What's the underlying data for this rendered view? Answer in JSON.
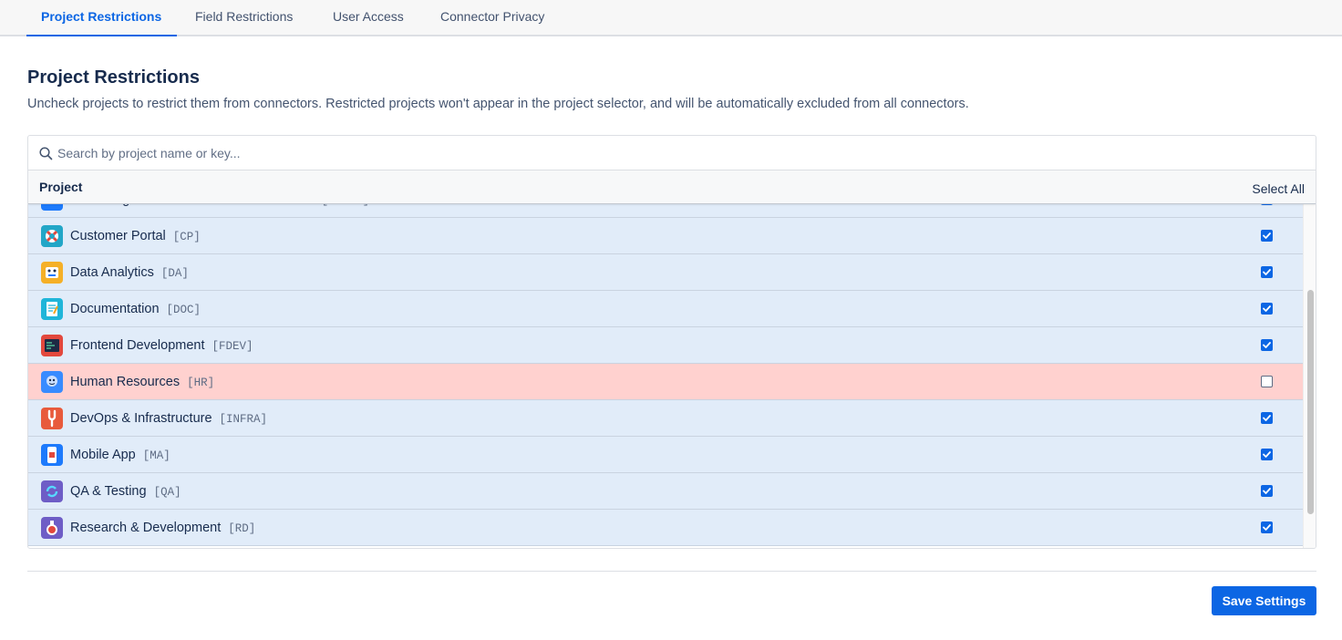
{
  "tabs": [
    {
      "label": "Project Restrictions",
      "active": true
    },
    {
      "label": "Field Restrictions",
      "active": false
    },
    {
      "label": "User Access",
      "active": false
    },
    {
      "label": "Connector Privacy",
      "active": false
    }
  ],
  "section": {
    "title": "Project Restrictions",
    "description": "Uncheck projects to restrict them from connectors. Restricted projects won't appear in the project selector, and will be automatically excluded from all connectors."
  },
  "search": {
    "placeholder": "Search by project name or key...",
    "value": ""
  },
  "table": {
    "header_project": "Project",
    "select_all": "Select All"
  },
  "projects": [
    {
      "name": "Cloud Migration & Modernization Initiative",
      "key": "[CLOUD]",
      "checked": true,
      "icon": "cloud-icon"
    },
    {
      "name": "Customer Portal",
      "key": "[CP]",
      "checked": true,
      "icon": "lifebuoy-icon"
    },
    {
      "name": "Data Analytics",
      "key": "[DA]",
      "checked": true,
      "icon": "robot-icon"
    },
    {
      "name": "Documentation",
      "key": "[DOC]",
      "checked": true,
      "icon": "notebook-icon"
    },
    {
      "name": "Frontend Development",
      "key": "[FDEV]",
      "checked": true,
      "icon": "code-editor-icon"
    },
    {
      "name": "Human Resources",
      "key": "[HR]",
      "checked": false,
      "icon": "people-icon"
    },
    {
      "name": "DevOps & Infrastructure",
      "key": "[INFRA]",
      "checked": true,
      "icon": "wrench-icon"
    },
    {
      "name": "Mobile App",
      "key": "[MA]",
      "checked": true,
      "icon": "phone-icon"
    },
    {
      "name": "QA & Testing",
      "key": "[QA]",
      "checked": true,
      "icon": "refresh-icon"
    },
    {
      "name": "Research & Development",
      "key": "[RD]",
      "checked": true,
      "icon": "flask-icon"
    }
  ],
  "footer": {
    "save_label": "Save Settings"
  },
  "colors": {
    "accent": "#0c66e4",
    "checked_row": "#e1ecf9",
    "restricted_row": "#ffd1cf"
  }
}
